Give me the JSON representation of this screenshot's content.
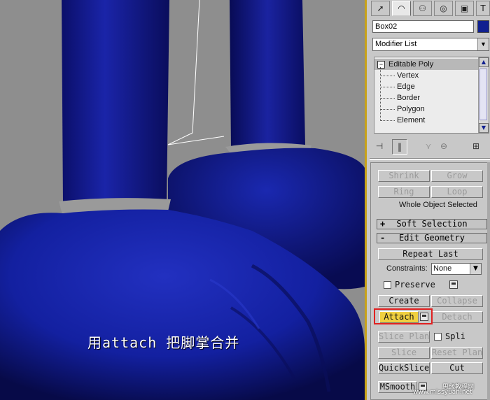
{
  "object_name": "Box02",
  "object_color": "#102090",
  "modifier_list": "Modifier List",
  "stack": {
    "root": "Editable Poly",
    "items": [
      "Vertex",
      "Edge",
      "Border",
      "Polygon",
      "Element"
    ]
  },
  "selection": {
    "shrink": "Shrink",
    "grow": "Grow",
    "ring": "Ring",
    "loop": "Loop",
    "status": "Whole Object Selected"
  },
  "rollouts": {
    "soft_selection": {
      "sign": "+",
      "label": "Soft Selection"
    },
    "edit_geometry": {
      "sign": "-",
      "label": "Edit Geometry"
    }
  },
  "edit_geometry": {
    "repeat_last": "Repeat Last",
    "constraints_label": "Constraints:",
    "constraints_value": "None",
    "preserve": "Preserve",
    "create": "Create",
    "collapse": "Collapse",
    "attach": "Attach",
    "detach": "Detach",
    "slice_plane": "Slice Plan",
    "split": "Spli",
    "slice": "Slice",
    "reset_plane": "Reset Plan",
    "quickslice": "QuickSlice",
    "cut": "Cut",
    "msmooth": "MSmooth"
  },
  "caption": "用attach 把脚掌合并",
  "watermark": {
    "line1": "思缘教程网",
    "line2": "www.missyuan.net"
  }
}
